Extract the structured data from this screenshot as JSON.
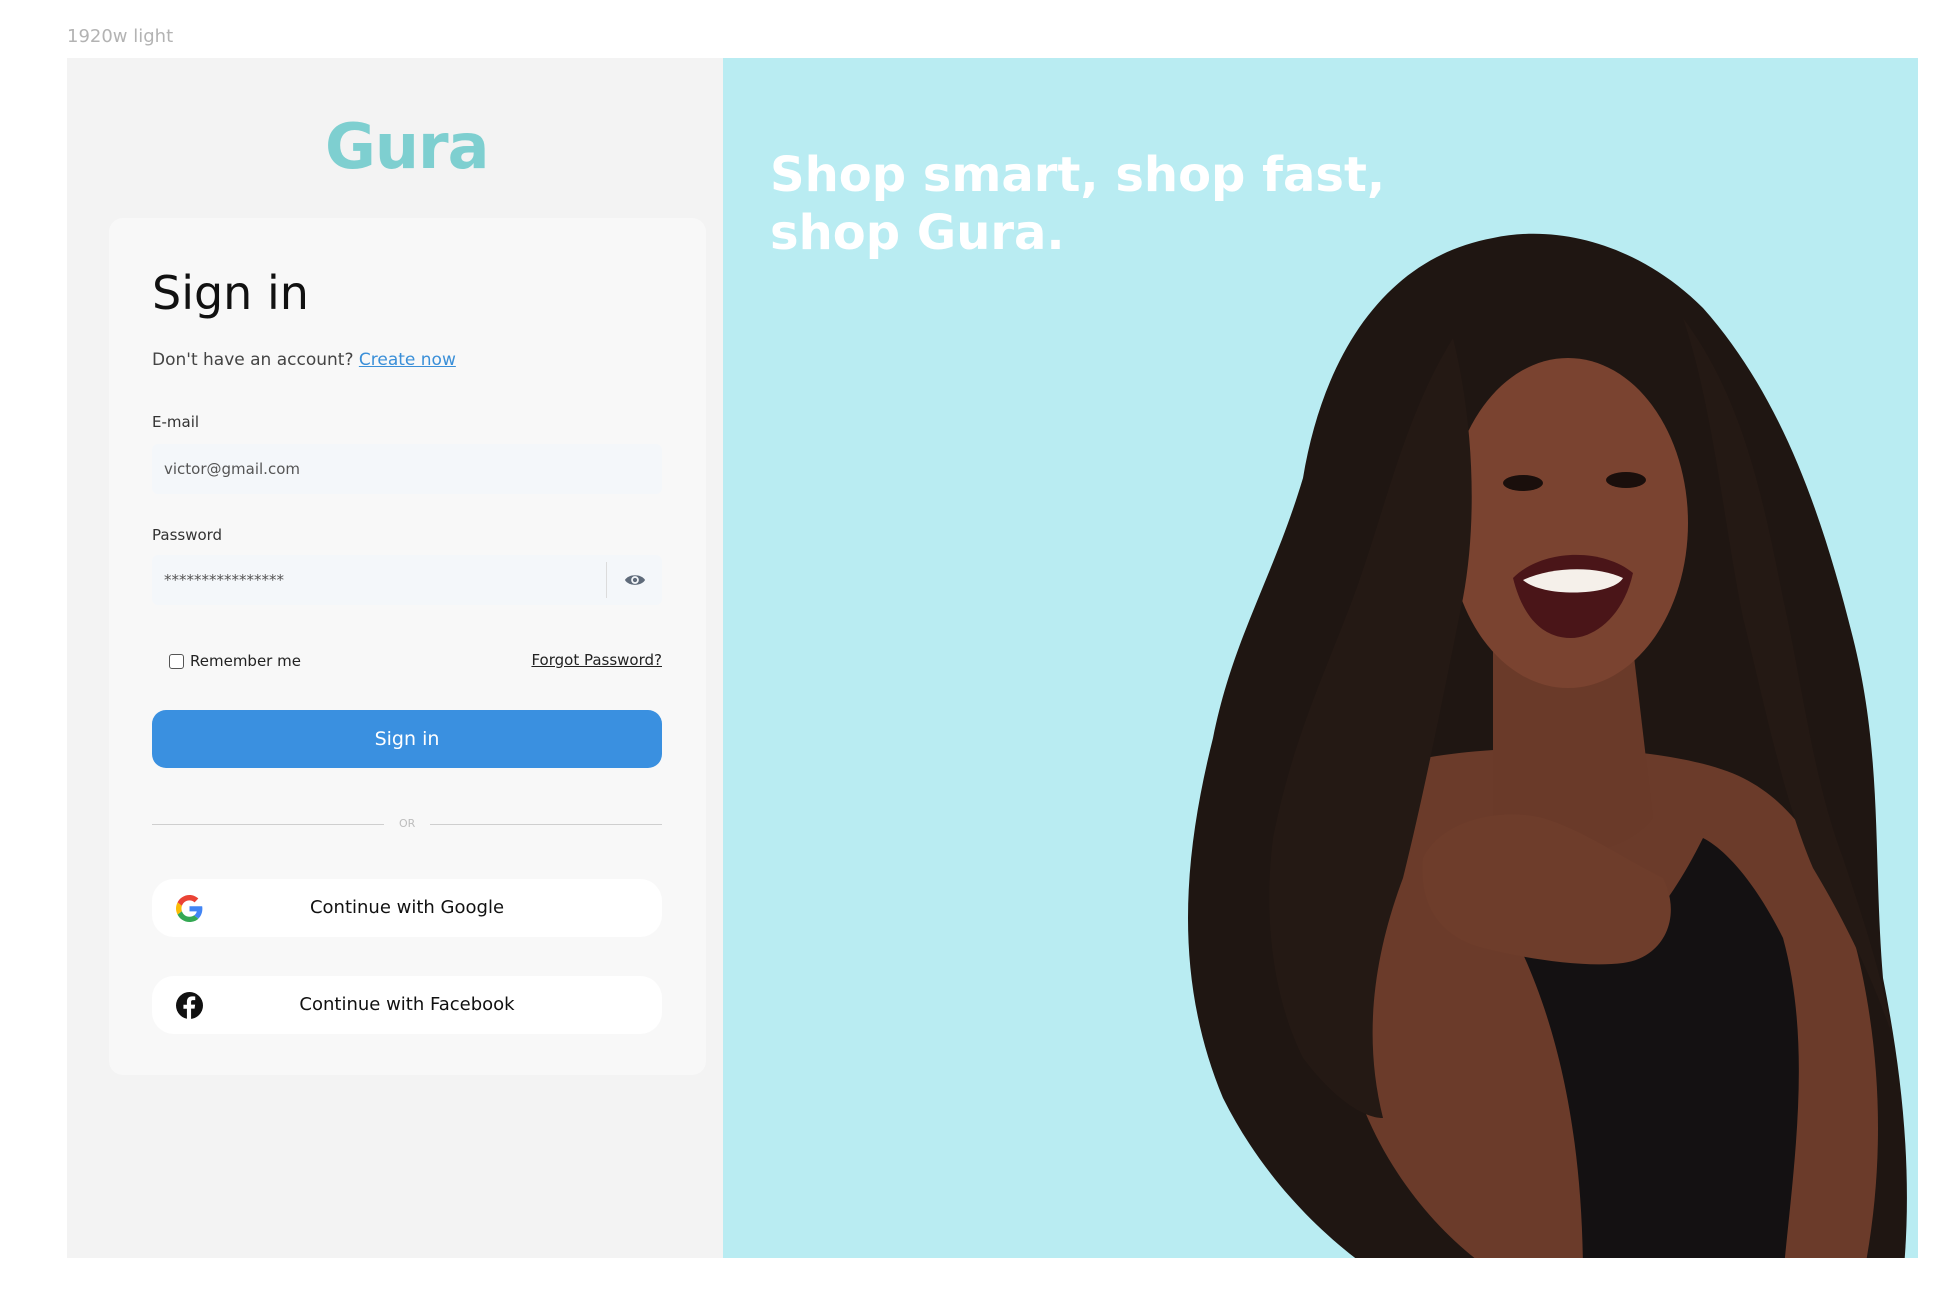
{
  "frame_label": "1920w light",
  "brand": {
    "logo": "Gura"
  },
  "form": {
    "title": "Sign in",
    "no_account_text": "Don't have an account? ",
    "create_link": "Create now",
    "email_label": "E-mail",
    "email_value": "victor@gmail.com",
    "password_label": "Password",
    "password_value": "****************",
    "remember_label": "Remember me",
    "forgot_label": "Forgot Password?",
    "submit_label": "Sign in",
    "or_label": "OR",
    "google_label": "Continue with Google",
    "facebook_label": "Continue with Facebook"
  },
  "promo": {
    "headline_line1": "Shop smart, shop fast,",
    "headline_line2": "shop Gura."
  },
  "colors": {
    "brand": "#7ecfd0",
    "primary_button": "#3a90e0",
    "link": "#3a8fd8",
    "hero_background": "#b9ecf2",
    "left_panel": "#f3f3f3"
  },
  "icons": [
    "eye-icon",
    "google-icon",
    "facebook-icon"
  ]
}
